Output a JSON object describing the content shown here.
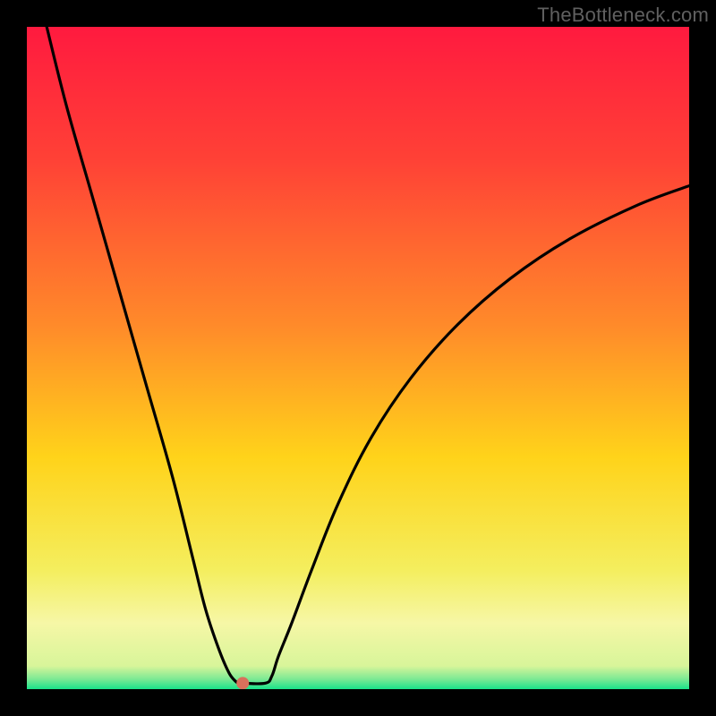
{
  "watermark": "TheBottleneck.com",
  "chart_data": {
    "type": "line",
    "title": "",
    "xlabel": "",
    "ylabel": "",
    "x_range": [
      0,
      100
    ],
    "y_range": [
      0,
      100
    ],
    "background": {
      "gradient_direction": "vertical",
      "stops": [
        {
          "pos": 0.0,
          "color": "#ff1a3f"
        },
        {
          "pos": 0.2,
          "color": "#ff4136"
        },
        {
          "pos": 0.45,
          "color": "#ff8a2a"
        },
        {
          "pos": 0.65,
          "color": "#ffd31a"
        },
        {
          "pos": 0.82,
          "color": "#f4ee5e"
        },
        {
          "pos": 0.9,
          "color": "#f6f7a6"
        },
        {
          "pos": 0.965,
          "color": "#d8f59a"
        },
        {
          "pos": 0.985,
          "color": "#7be994"
        },
        {
          "pos": 1.0,
          "color": "#19e28a"
        }
      ]
    },
    "series": [
      {
        "name": "curve",
        "color": "#000000",
        "x": [
          3,
          6,
          10,
          14,
          18,
          22,
          25,
          27,
          29,
          30.5,
          31.5,
          32,
          32.6,
          36,
          37,
          38,
          40,
          43,
          47,
          52,
          58,
          65,
          73,
          82,
          92,
          100
        ],
        "y": [
          100,
          88,
          74,
          60,
          46,
          32,
          20,
          12,
          6,
          2.5,
          1.2,
          0.9,
          0.9,
          0.9,
          2,
          5,
          10,
          18,
          28,
          38,
          47,
          55,
          62,
          68,
          73,
          76
        ]
      }
    ],
    "marker": {
      "x": 32.6,
      "y": 0.9,
      "color": "#d8705b",
      "radius": 7
    }
  }
}
